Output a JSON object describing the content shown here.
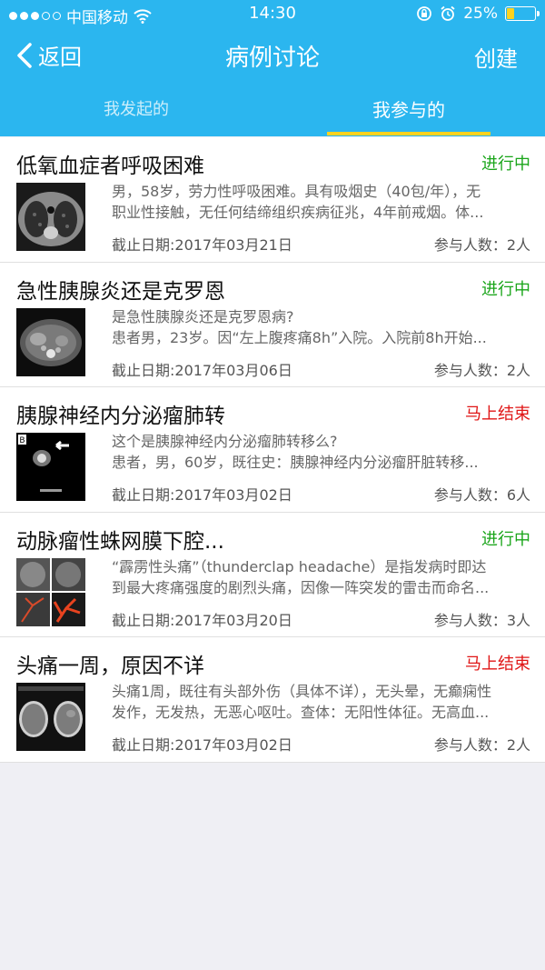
{
  "status_bar": {
    "carrier": "中国移动",
    "time": "14:30",
    "battery": "25%",
    "battery_level": 0.25,
    "icons": [
      "signal-icon",
      "wifi-icon",
      "rotation-lock-icon",
      "alarm-icon",
      "battery-icon"
    ]
  },
  "nav": {
    "back_label": "返回",
    "title": "病例讨论",
    "create_label": "创建"
  },
  "tabs": [
    {
      "label": "我发起的",
      "active": false
    },
    {
      "label": "我参与的",
      "active": true
    }
  ],
  "colors": {
    "header_bg": "#2bb6ef",
    "tab_indicator": "#ffd21f",
    "status_in_progress": "#1aa51a",
    "status_ending": "#e01616"
  },
  "cases": [
    {
      "title": "低氧血症者呼吸困难",
      "status": "进行中",
      "status_color": "green",
      "desc_line1": "男，58岁，劳力性呼吸困难。具有吸烟史（40包/年），无",
      "desc_line2": "职业性接触，无任何结缔组织疾病征兆，4年前戒烟。体...",
      "deadline": "截止日期:2017年03月21日",
      "participants": "参与人数：2人",
      "thumb": "chest-ct-image"
    },
    {
      "title": "急性胰腺炎还是克罗恩",
      "status": "进行中",
      "status_color": "green",
      "desc_line1": "是急性胰腺炎还是克罗恩病?",
      "desc_line2": "患者男，23岁。因“左上腹疼痛8h”入院。入院前8h开始...",
      "deadline": "截止日期:2017年03月06日",
      "participants": "参与人数：2人",
      "thumb": "abdominal-ct-image"
    },
    {
      "title": "胰腺神经内分泌瘤肺转",
      "status": "马上结束",
      "status_color": "red",
      "desc_line1": "这个是胰腺神经内分泌瘤肺转移么?",
      "desc_line2": "患者，男，60岁，既往史：胰腺神经内分泌瘤肝脏转移...",
      "deadline": "截止日期:2017年03月02日",
      "participants": "参与人数：6人",
      "thumb": "pet-scan-image",
      "thumb_label": "B"
    },
    {
      "title": "动脉瘤性蛛网膜下腔...",
      "status": "进行中",
      "status_color": "green",
      "desc_line1": "“霹雳性头痛”（thunderclap headache）是指发病时即达",
      "desc_line2": "到最大疼痛强度的剧烈头痛，因像一阵突发的雷击而命名...",
      "deadline": "截止日期:2017年03月20日",
      "participants": "参与人数：3人",
      "thumb": "cerebral-angiography-image"
    },
    {
      "title": "头痛一周，原因不详",
      "status": "马上结束",
      "status_color": "red",
      "desc_line1": "头痛1周，既往有头部外伤（具体不详），无头晕，无癫痫性",
      "desc_line2": "发作，无发热，无恶心呕吐。查体：无阳性体征。无高血...",
      "deadline": "截止日期:2017年03月02日",
      "participants": "参与人数：2人",
      "thumb": "brain-ct-image"
    }
  ]
}
